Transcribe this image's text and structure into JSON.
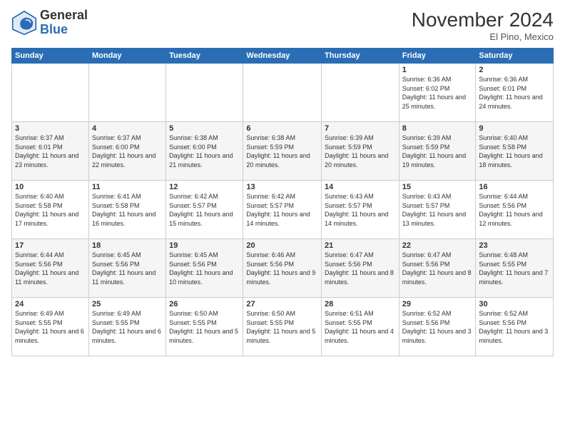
{
  "header": {
    "logo_general": "General",
    "logo_blue": "Blue",
    "month_title": "November 2024",
    "location": "El Pino, Mexico"
  },
  "weekdays": [
    "Sunday",
    "Monday",
    "Tuesday",
    "Wednesday",
    "Thursday",
    "Friday",
    "Saturday"
  ],
  "weeks": [
    [
      {
        "day": "",
        "info": ""
      },
      {
        "day": "",
        "info": ""
      },
      {
        "day": "",
        "info": ""
      },
      {
        "day": "",
        "info": ""
      },
      {
        "day": "",
        "info": ""
      },
      {
        "day": "1",
        "info": "Sunrise: 6:36 AM\nSunset: 6:02 PM\nDaylight: 11 hours and 25 minutes."
      },
      {
        "day": "2",
        "info": "Sunrise: 6:36 AM\nSunset: 6:01 PM\nDaylight: 11 hours and 24 minutes."
      }
    ],
    [
      {
        "day": "3",
        "info": "Sunrise: 6:37 AM\nSunset: 6:01 PM\nDaylight: 11 hours and 23 minutes."
      },
      {
        "day": "4",
        "info": "Sunrise: 6:37 AM\nSunset: 6:00 PM\nDaylight: 11 hours and 22 minutes."
      },
      {
        "day": "5",
        "info": "Sunrise: 6:38 AM\nSunset: 6:00 PM\nDaylight: 11 hours and 21 minutes."
      },
      {
        "day": "6",
        "info": "Sunrise: 6:38 AM\nSunset: 5:59 PM\nDaylight: 11 hours and 20 minutes."
      },
      {
        "day": "7",
        "info": "Sunrise: 6:39 AM\nSunset: 5:59 PM\nDaylight: 11 hours and 20 minutes."
      },
      {
        "day": "8",
        "info": "Sunrise: 6:39 AM\nSunset: 5:59 PM\nDaylight: 11 hours and 19 minutes."
      },
      {
        "day": "9",
        "info": "Sunrise: 6:40 AM\nSunset: 5:58 PM\nDaylight: 11 hours and 18 minutes."
      }
    ],
    [
      {
        "day": "10",
        "info": "Sunrise: 6:40 AM\nSunset: 5:58 PM\nDaylight: 11 hours and 17 minutes."
      },
      {
        "day": "11",
        "info": "Sunrise: 6:41 AM\nSunset: 5:58 PM\nDaylight: 11 hours and 16 minutes."
      },
      {
        "day": "12",
        "info": "Sunrise: 6:42 AM\nSunset: 5:57 PM\nDaylight: 11 hours and 15 minutes."
      },
      {
        "day": "13",
        "info": "Sunrise: 6:42 AM\nSunset: 5:57 PM\nDaylight: 11 hours and 14 minutes."
      },
      {
        "day": "14",
        "info": "Sunrise: 6:43 AM\nSunset: 5:57 PM\nDaylight: 11 hours and 14 minutes."
      },
      {
        "day": "15",
        "info": "Sunrise: 6:43 AM\nSunset: 5:57 PM\nDaylight: 11 hours and 13 minutes."
      },
      {
        "day": "16",
        "info": "Sunrise: 6:44 AM\nSunset: 5:56 PM\nDaylight: 11 hours and 12 minutes."
      }
    ],
    [
      {
        "day": "17",
        "info": "Sunrise: 6:44 AM\nSunset: 5:56 PM\nDaylight: 11 hours and 11 minutes."
      },
      {
        "day": "18",
        "info": "Sunrise: 6:45 AM\nSunset: 5:56 PM\nDaylight: 11 hours and 11 minutes."
      },
      {
        "day": "19",
        "info": "Sunrise: 6:45 AM\nSunset: 5:56 PM\nDaylight: 11 hours and 10 minutes."
      },
      {
        "day": "20",
        "info": "Sunrise: 6:46 AM\nSunset: 5:56 PM\nDaylight: 11 hours and 9 minutes."
      },
      {
        "day": "21",
        "info": "Sunrise: 6:47 AM\nSunset: 5:56 PM\nDaylight: 11 hours and 8 minutes."
      },
      {
        "day": "22",
        "info": "Sunrise: 6:47 AM\nSunset: 5:56 PM\nDaylight: 11 hours and 8 minutes."
      },
      {
        "day": "23",
        "info": "Sunrise: 6:48 AM\nSunset: 5:55 PM\nDaylight: 11 hours and 7 minutes."
      }
    ],
    [
      {
        "day": "24",
        "info": "Sunrise: 6:49 AM\nSunset: 5:55 PM\nDaylight: 11 hours and 6 minutes."
      },
      {
        "day": "25",
        "info": "Sunrise: 6:49 AM\nSunset: 5:55 PM\nDaylight: 11 hours and 6 minutes."
      },
      {
        "day": "26",
        "info": "Sunrise: 6:50 AM\nSunset: 5:55 PM\nDaylight: 11 hours and 5 minutes."
      },
      {
        "day": "27",
        "info": "Sunrise: 6:50 AM\nSunset: 5:55 PM\nDaylight: 11 hours and 5 minutes."
      },
      {
        "day": "28",
        "info": "Sunrise: 6:51 AM\nSunset: 5:55 PM\nDaylight: 11 hours and 4 minutes."
      },
      {
        "day": "29",
        "info": "Sunrise: 6:52 AM\nSunset: 5:56 PM\nDaylight: 11 hours and 3 minutes."
      },
      {
        "day": "30",
        "info": "Sunrise: 6:52 AM\nSunset: 5:56 PM\nDaylight: 11 hours and 3 minutes."
      }
    ]
  ]
}
